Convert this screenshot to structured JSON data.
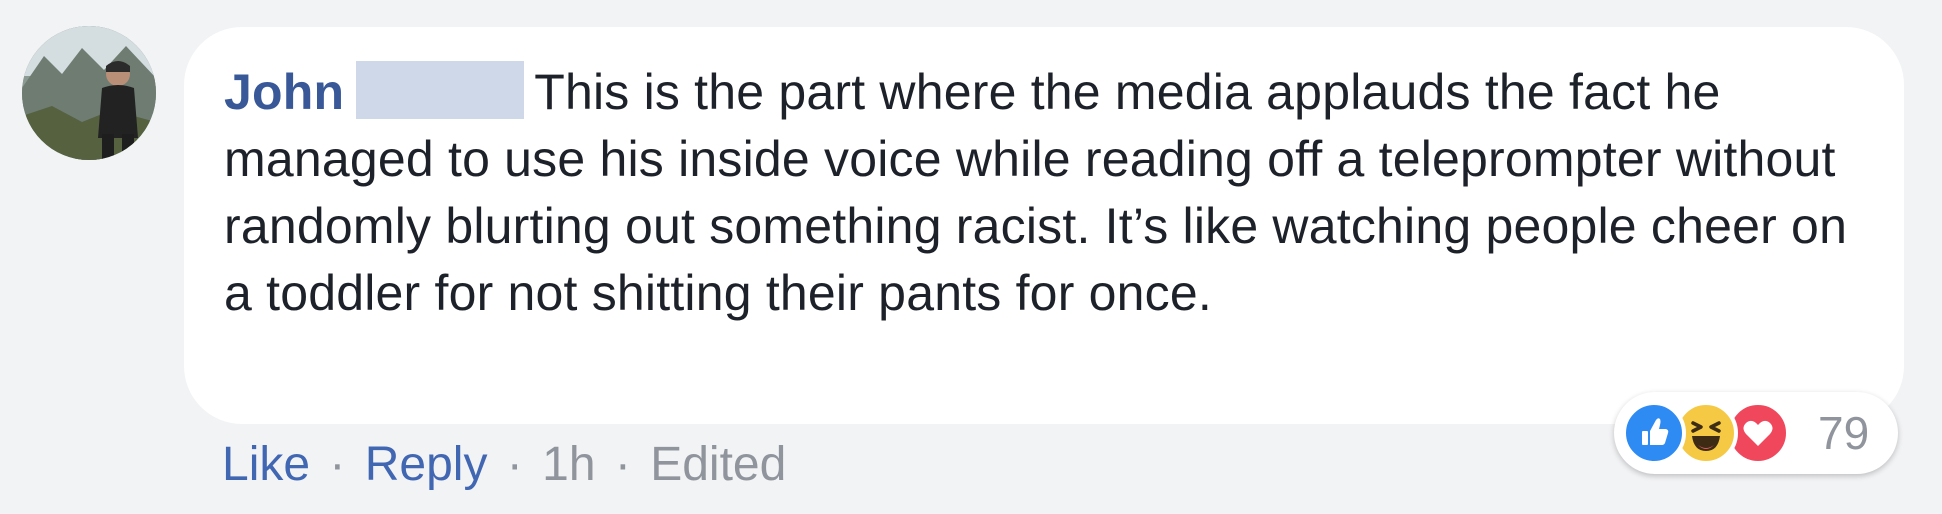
{
  "comment": {
    "author": "John",
    "text": "This is the part where the media applauds the fact he managed to use his inside voice while reading off a teleprompter without randomly blurting out something racist. It’s like watching people cheer on a toddler for not shitting their pants for once."
  },
  "actions": {
    "like_label": "Like",
    "reply_label": "Reply",
    "separator": "·",
    "time": "1h",
    "edited_label": "Edited"
  },
  "reactions": {
    "icons": [
      "like-icon",
      "haha-icon",
      "love-icon"
    ],
    "count": "79"
  },
  "colors": {
    "author": "#385898",
    "link": "#4267b2",
    "meta": "#90949c",
    "like": "#2e8bf3",
    "haha": "#f6c944",
    "love": "#f0475c"
  }
}
